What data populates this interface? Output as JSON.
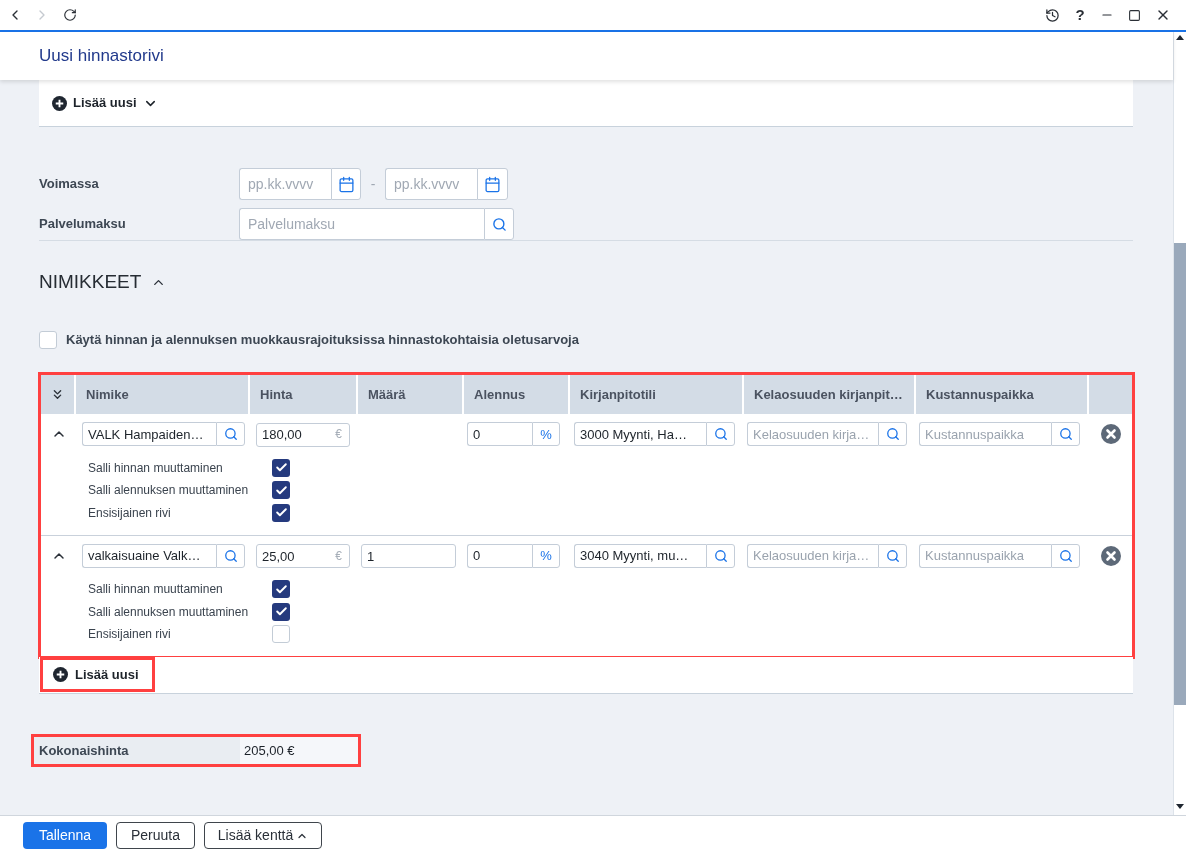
{
  "browser": {
    "help": "?"
  },
  "page": {
    "title": "Uusi hinnastorivi"
  },
  "toolbar": {
    "add_label": "Lisää uusi"
  },
  "form": {
    "fields": [
      {
        "kind": "date_range",
        "label": "Voimassa",
        "start_placeholder": "pp.kk.vvvv",
        "separator": "-",
        "end_placeholder": "pp.kk.vvvv"
      },
      {
        "kind": "search",
        "label": "Palvelumaksu",
        "placeholder": "Palvelumaksu"
      }
    ]
  },
  "section": {
    "title": "NIMIKKEET",
    "expanded": true
  },
  "defaults_option": {
    "label": "Käytä hinnan ja alennuksen muokkausrajoituksissa hinnastokohtaisia oletusarvoja",
    "checked": false
  },
  "table": {
    "highlighted": true,
    "columns": [
      "Nimike",
      "Hinta",
      "Määrä",
      "Alennus",
      "Kirjanpitotili",
      "Kelaosuuden kirjanpit…",
      "Kustannuspaikka"
    ],
    "rows": [
      {
        "expanded": true,
        "item": "VALK Hampaiden…",
        "price": "180,00",
        "price_unit": "€",
        "discount": "0",
        "discount_unit": "%",
        "account": "3000 Myynti, Ha…",
        "kela_account_placeholder": "Kelaosuuden kirja…",
        "cost_center_placeholder": "Kustannuspaikka",
        "options": [
          {
            "label": "Salli hinnan muuttaminen",
            "checked": true
          },
          {
            "label": "Salli alennuksen muuttaminen",
            "checked": true
          },
          {
            "label": "Ensisijainen rivi",
            "checked": true
          }
        ]
      },
      {
        "expanded": true,
        "item": "valkaisuaine Valk…",
        "price": "25,00",
        "price_unit": "€",
        "quantity": "1",
        "discount": "0",
        "discount_unit": "%",
        "account": "3040 Myynti, mu…",
        "kela_account_placeholder": "Kelaosuuden kirja…",
        "cost_center_placeholder": "Kustannuspaikka",
        "options": [
          {
            "label": "Salli hinnan muuttaminen",
            "checked": true
          },
          {
            "label": "Salli alennuksen muuttaminen",
            "checked": true
          },
          {
            "label": "Ensisijainen rivi",
            "checked": false
          }
        ]
      }
    ]
  },
  "add_row": {
    "label": "Lisää uusi",
    "highlighted": true
  },
  "total": {
    "label": "Kokonaishinta",
    "value": "205,00 €",
    "highlighted": true
  },
  "footer": {
    "buttons": [
      {
        "kind": "primary",
        "label": "Tallenna"
      },
      {
        "kind": "secondary",
        "label": "Peruuta"
      },
      {
        "kind": "menu",
        "label": "Lisää kenttä"
      }
    ]
  }
}
